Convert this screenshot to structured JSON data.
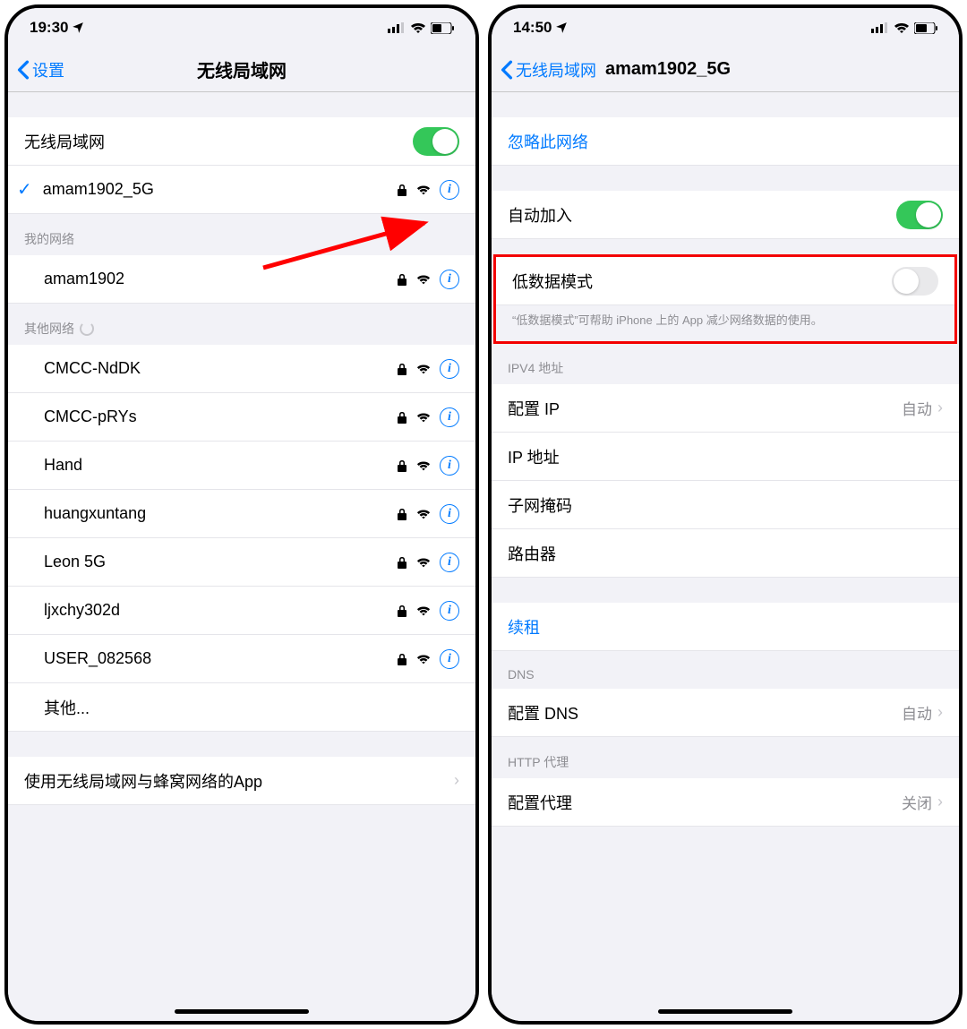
{
  "left": {
    "status": {
      "time": "19:30"
    },
    "nav": {
      "back": "设置",
      "title": "无线局域网"
    },
    "wifi_toggle_label": "无线局域网",
    "connected": {
      "name": "amam1902_5G"
    },
    "my_networks_header": "我的网络",
    "my_networks": [
      {
        "name": "amam1902"
      }
    ],
    "other_networks_header": "其他网络",
    "other_networks": [
      {
        "name": "CMCC-NdDK"
      },
      {
        "name": "CMCC-pRYs"
      },
      {
        "name": "Hand"
      },
      {
        "name": "huangxuntang"
      },
      {
        "name": "Leon 5G"
      },
      {
        "name": "ljxchy302d"
      },
      {
        "name": "USER_082568"
      }
    ],
    "other_label": "其他...",
    "apps_cell": "使用无线局域网与蜂窝网络的App"
  },
  "right": {
    "status": {
      "time": "14:50"
    },
    "nav": {
      "back": "无线局域网",
      "title": "amam1902_5G"
    },
    "forget": "忽略此网络",
    "auto_join": "自动加入",
    "low_data": "低数据模式",
    "low_data_desc": "“低数据模式”可帮助 iPhone 上的 App 减少网络数据的使用。",
    "ipv4_header": "IPV4 地址",
    "configure_ip_label": "配置 IP",
    "configure_ip_value": "自动",
    "ip_address_label": "IP 地址",
    "subnet_label": "子网掩码",
    "router_label": "路由器",
    "renew_lease": "续租",
    "dns_header": "DNS",
    "configure_dns_label": "配置 DNS",
    "configure_dns_value": "自动",
    "http_proxy_header": "HTTP 代理",
    "configure_proxy_label": "配置代理",
    "configure_proxy_value": "关闭"
  }
}
